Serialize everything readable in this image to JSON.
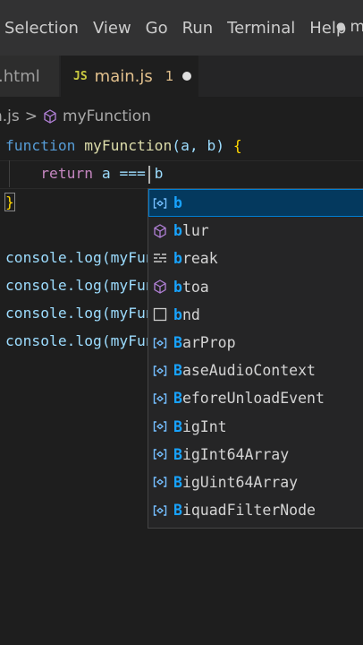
{
  "menu": [
    "Selection",
    "View",
    "Go",
    "Run",
    "Terminal",
    "Help"
  ],
  "window_title": "ma",
  "tabs": {
    "html_label": ".html",
    "main_icon": "JS",
    "main_label": "main.js",
    "main_badge": "1"
  },
  "breadcrumb": {
    "file": "n.js",
    "symbol": "myFunction"
  },
  "code": {
    "line1_kw": "function",
    "line1_name": "myFunction",
    "line1_params": "(a, b) ",
    "line1_brace": "{",
    "line2_kw": "return",
    "line2_expr": " a === b",
    "line3_brace": "}",
    "console_lines": [
      "console.log(myFunc",
      "console.log(myFunc",
      "console.log(myFunc",
      "console.log(myFunc"
    ]
  },
  "suggestions": [
    {
      "match": "b",
      "rest": "",
      "icon": "variable-icon",
      "selected": true
    },
    {
      "match": "b",
      "rest": "lur",
      "icon": "method-cube-icon"
    },
    {
      "match": "b",
      "rest": "reak",
      "icon": "keyword-icon"
    },
    {
      "match": "b",
      "rest": "toa",
      "icon": "method-cube-icon"
    },
    {
      "match": "b",
      "rest": "nd",
      "icon": "snippet-square-icon"
    },
    {
      "match": "B",
      "rest": "arProp",
      "icon": "variable-icon"
    },
    {
      "match": "B",
      "rest": "aseAudioContext",
      "icon": "variable-icon"
    },
    {
      "match": "B",
      "rest": "eforeUnloadEvent",
      "icon": "variable-icon"
    },
    {
      "match": "B",
      "rest": "igInt",
      "icon": "variable-icon"
    },
    {
      "match": "B",
      "rest": "igInt64Array",
      "icon": "variable-icon"
    },
    {
      "match": "B",
      "rest": "igUint64Array",
      "icon": "variable-icon"
    },
    {
      "match": "B",
      "rest": "iquadFilterNode",
      "icon": "variable-icon"
    }
  ],
  "colors": {
    "highlight": "#18a3ff",
    "modified_tab": "#e2c08d",
    "keyword": "#569cd6",
    "function": "#dcdcaa"
  }
}
